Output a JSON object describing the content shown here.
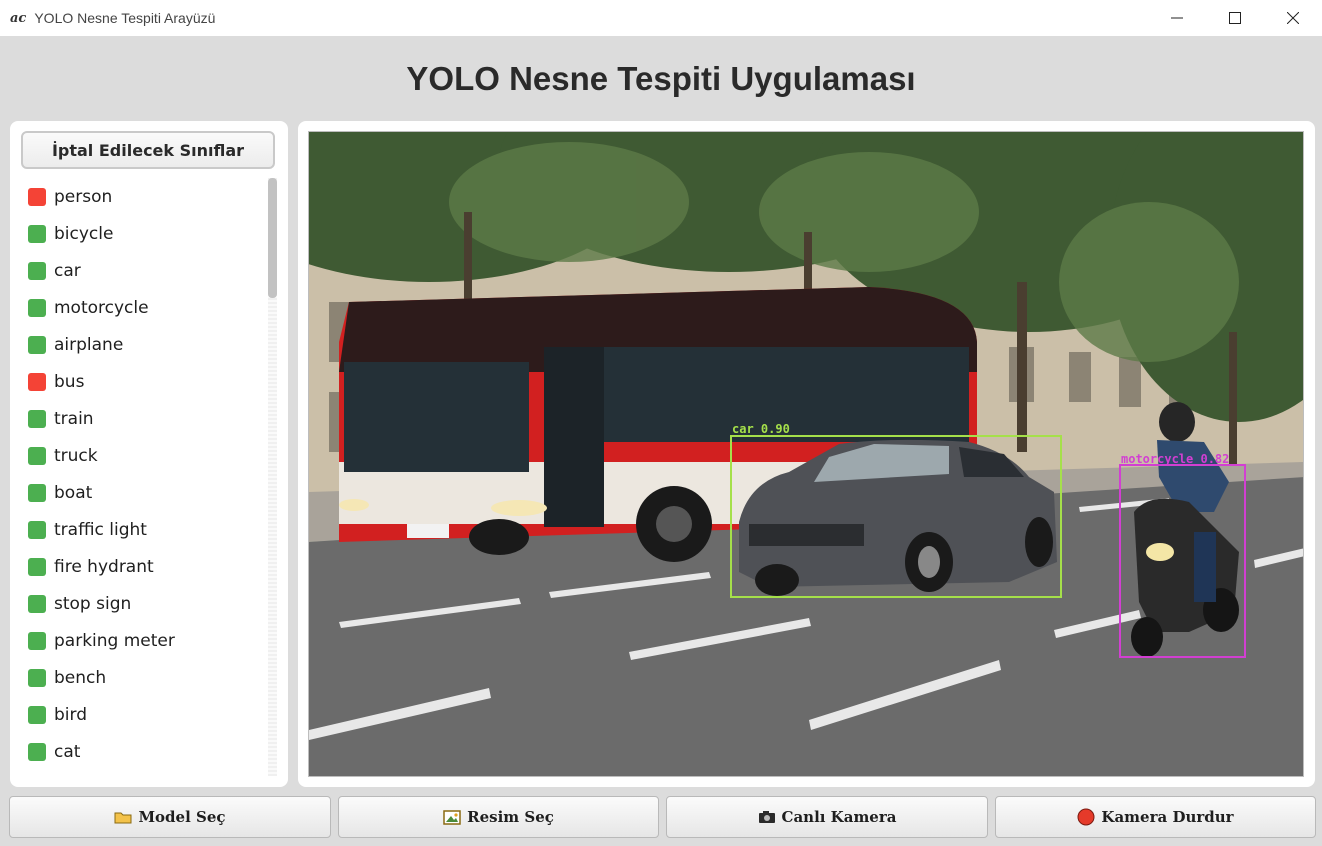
{
  "window": {
    "logo": "ac",
    "title": "YOLO Nesne Tespiti Arayüzü"
  },
  "app_heading": "YOLO Nesne Tespiti Uygulaması",
  "class_panel": {
    "header": "İptal Edilecek Sınıflar",
    "items": [
      {
        "label": "person",
        "enabled": false
      },
      {
        "label": "bicycle",
        "enabled": true
      },
      {
        "label": "car",
        "enabled": true
      },
      {
        "label": "motorcycle",
        "enabled": true
      },
      {
        "label": "airplane",
        "enabled": true
      },
      {
        "label": "bus",
        "enabled": false
      },
      {
        "label": "train",
        "enabled": true
      },
      {
        "label": "truck",
        "enabled": true
      },
      {
        "label": "boat",
        "enabled": true
      },
      {
        "label": "traffic light",
        "enabled": true
      },
      {
        "label": "fire hydrant",
        "enabled": true
      },
      {
        "label": "stop sign",
        "enabled": true
      },
      {
        "label": "parking meter",
        "enabled": true
      },
      {
        "label": "bench",
        "enabled": true
      },
      {
        "label": "bird",
        "enabled": true
      },
      {
        "label": "cat",
        "enabled": true
      }
    ],
    "colors": {
      "enabled": "#4caf50",
      "disabled": "#f44336"
    }
  },
  "detections": [
    {
      "label": "car 0.90",
      "color": "#a5e04a"
    },
    {
      "label": "motorcycle 0.82",
      "color": "#d23fd2"
    }
  ],
  "buttons": {
    "model": "Model Seç",
    "image": "Resim Seç",
    "camera": "Canlı Kamera",
    "stop": "Kamera Durdur"
  }
}
